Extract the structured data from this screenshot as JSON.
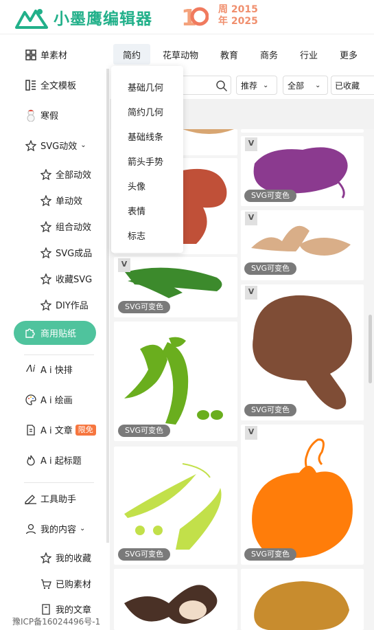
{
  "brand": {
    "name": "小墨鹰编辑器",
    "anniversary_number": "10",
    "anniversary_line1": "周 2015",
    "anniversary_line2": "年 2025",
    "accent": "#22b08a"
  },
  "sidebar": {
    "items": [
      {
        "label": "单素材",
        "icon": "grid-icon"
      },
      {
        "label": "全文模板",
        "icon": "template-icon"
      },
      {
        "label": "寒假",
        "icon": "snowman-icon"
      },
      {
        "label": "SVG动效",
        "icon": "star-outline-icon"
      },
      {
        "label": "全部动效",
        "icon": "star-outline-icon"
      },
      {
        "label": "单动效",
        "icon": "star-outline-icon"
      },
      {
        "label": "组合动效",
        "icon": "star-outline-icon"
      },
      {
        "label": "SVG成品",
        "icon": "star-outline-icon"
      },
      {
        "label": "收藏SVG",
        "icon": "star-outline-icon"
      },
      {
        "label": "DIY作品",
        "icon": "star-outline-icon"
      },
      {
        "label": "商用贴纸",
        "icon": "puzzle-icon"
      },
      {
        "label": "A i 快排",
        "icon": "ai-icon"
      },
      {
        "label": "A i 绘画",
        "icon": "palette-icon"
      },
      {
        "label": "A i 文章",
        "icon": "doc-icon",
        "badge": "限免"
      },
      {
        "label": "A i 起标题",
        "icon": "flame-icon"
      },
      {
        "label": "工具助手",
        "icon": "tool-icon"
      },
      {
        "label": "我的内容",
        "icon": "user-icon"
      },
      {
        "label": "我的收藏",
        "icon": "star-outline-icon"
      },
      {
        "label": "已购素材",
        "icon": "cart-icon"
      },
      {
        "label": "我的文章",
        "icon": "doc-icon"
      }
    ],
    "active_color": "#4fc39d",
    "icp": "豫ICP备16024496号-1"
  },
  "tabs": [
    "简约",
    "花草动物",
    "教育",
    "商务",
    "行业",
    "更多"
  ],
  "filters": {
    "sort": "推荐",
    "scope": "全部",
    "collected": "已收藏"
  },
  "dropdown": [
    "基础几何",
    "简约几何",
    "基础线条",
    "箭头手势",
    "头像",
    "表情",
    "标志"
  ],
  "cards": {
    "vtag": "V",
    "svg_label": "SVG可变色"
  },
  "colors": {
    "purple": "#8b3a8f",
    "tan": "#d9ae88",
    "brown": "#7f4d36",
    "green": "#6aae1e",
    "lime": "#c2e04a",
    "orange": "#ff7d0a",
    "red": "#c05038",
    "mustard": "#c88c2e",
    "vegetable": "#3c8a2c"
  }
}
